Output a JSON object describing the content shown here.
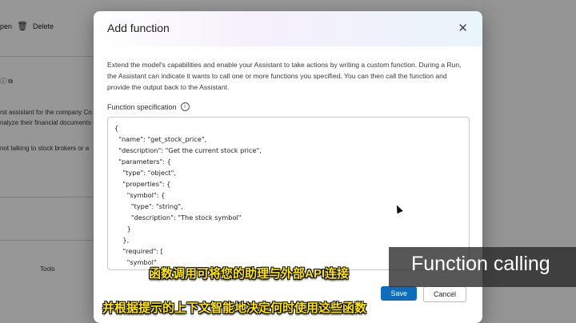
{
  "background": {
    "toolbar": {
      "open_label": "pen",
      "delete_label": "Delete"
    },
    "instruction_lines": [
      "rst assistant for the company Co",
      "nalyze their financial documents",
      "not talking to stock brokers or a"
    ],
    "tools_label": "Tools"
  },
  "modal": {
    "title": "Add function",
    "description": "Extend the model's capabilities and enable your Assistant to take actions by writing a custom function. During a Run, the Assistant can indicate it wants to call one or more functions you specified. You can then call the function and provide the output back to the Assistant.",
    "spec_label": "Function specification",
    "code": "{\n  \"name\": \"get_stock_price\",\n  \"description\": \"Get the current stock price\",\n  \"parameters\": {\n    \"type\": \"object\",\n    \"properties\": {\n      \"symbol\": {\n        \"type\": \"string\",\n        \"description\": \"The stock symbol\"\n      }\n    },\n    \"required\": [\n      \"symbol\"",
    "save_label": "Save",
    "cancel_label": "Cancel"
  },
  "overlay": {
    "banner": "Function calling",
    "subtitle_line1": "函数调用可将您的助理与外部API连接",
    "subtitle_line2": "并根据提示的上下文智能地决定何时使用这些函数"
  },
  "colors": {
    "primary": "#0f6cbd",
    "subtitle": "#ffe600"
  }
}
